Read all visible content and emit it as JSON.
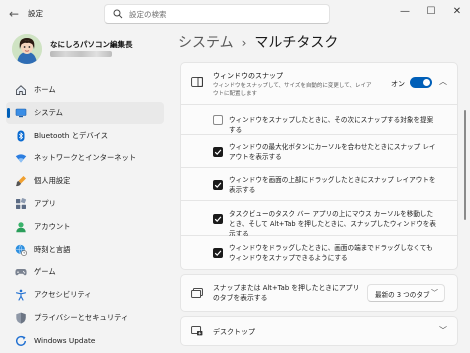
{
  "window": {
    "title": "設定",
    "controls": {
      "minimize": "—",
      "maximize": "☐",
      "close": "✕"
    }
  },
  "search": {
    "placeholder": "設定の検索"
  },
  "profile": {
    "name": "なにしろパソコン編集長"
  },
  "sidebar": {
    "items": [
      {
        "label": "ホーム",
        "icon": "home-icon"
      },
      {
        "label": "システム",
        "icon": "system-icon",
        "active": true
      },
      {
        "label": "Bluetooth とデバイス",
        "icon": "bluetooth-icon"
      },
      {
        "label": "ネットワークとインターネット",
        "icon": "network-icon"
      },
      {
        "label": "個人用設定",
        "icon": "brush-icon"
      },
      {
        "label": "アプリ",
        "icon": "apps-icon"
      },
      {
        "label": "アカウント",
        "icon": "account-icon"
      },
      {
        "label": "時刻と言語",
        "icon": "time-language-icon"
      },
      {
        "label": "ゲーム",
        "icon": "game-icon"
      },
      {
        "label": "アクセシビリティ",
        "icon": "accessibility-icon"
      },
      {
        "label": "プライバシーとセキュリティ",
        "icon": "shield-icon"
      },
      {
        "label": "Windows Update",
        "icon": "windows-update-icon"
      }
    ]
  },
  "breadcrumb": {
    "parent": "システム",
    "separator": "›",
    "current": "マルチタスク"
  },
  "snap": {
    "title": "ウィンドウのスナップ",
    "description": "ウィンドウをスナップして、サイズを自動的に変更して、レイアウトに配置します",
    "toggle_label": "オン",
    "toggle_on": true,
    "options": [
      {
        "label": "ウィンドウをスナップしたときに、その次にスナップする対象を提案する",
        "checked": false
      },
      {
        "label": "ウィンドウの最大化ボタンにカーソルを合わせたときにスナップ レイアウトを表示する",
        "checked": true
      },
      {
        "label": "ウィンドウを画面の上部にドラッグしたときにスナップ レイアウトを表示する",
        "checked": true
      },
      {
        "label": "タスクビューのタスク バー アプリの上にマウス カーソルを移動したとき、そして Alt+Tab を押したときに、スナップしたウィンドウを表示する",
        "checked": true
      },
      {
        "label": "ウィンドウをドラッグしたときに、画面の端までドラッグしなくてもウィンドウをスナップできるようにする",
        "checked": true
      }
    ]
  },
  "alttab": {
    "label": "スナップまたは Alt+Tab を押したときにアプリのタブを表示する",
    "selected": "最新の 3 つのタブ"
  },
  "desktop": {
    "label": "デスクトップ"
  },
  "colors": {
    "accent": "#005fb8",
    "background": "#f3f3f3",
    "card": "#fbfbfb"
  }
}
